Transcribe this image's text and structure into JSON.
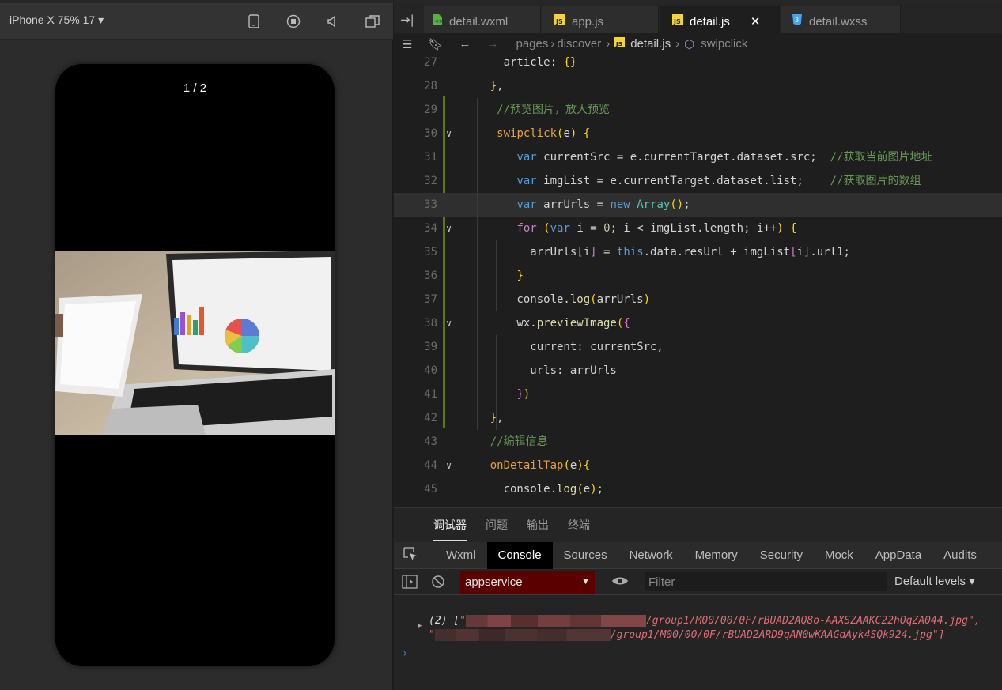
{
  "simulator": {
    "device": "iPhone X 75% 17 ▾",
    "pager": "1 / 2"
  },
  "tabs": [
    {
      "label": "detail.wxml",
      "icon": "wxml-file-icon"
    },
    {
      "label": "app.js",
      "icon": "js-file-icon"
    },
    {
      "label": "detail.js",
      "icon": "js-file-icon",
      "active": true,
      "close": "✕"
    },
    {
      "label": "detail.wxss",
      "icon": "css-file-icon"
    }
  ],
  "breadcrumb": {
    "parts": [
      "pages",
      "discover",
      "detail.js",
      "swipclick"
    ]
  },
  "editor": {
    "lines": [
      {
        "n": "27",
        "t": [
          [
            "v",
            "      article: "
          ],
          [
            "p1",
            "{}"
          ]
        ]
      },
      {
        "n": "28",
        "t": [
          [
            "v",
            "    "
          ],
          [
            "p1",
            "}"
          ],
          [
            "v",
            ","
          ]
        ]
      },
      {
        "n": "29",
        "t": [
          [
            "v",
            "     "
          ],
          [
            "c",
            "//预览图片，放大预览"
          ]
        ]
      },
      {
        "n": "30",
        "t": [
          [
            "v",
            "     "
          ],
          [
            "fn",
            "swipclick"
          ],
          [
            "p1",
            "("
          ],
          [
            "v",
            "e"
          ],
          [
            "p1",
            ")"
          ],
          [
            "v",
            " "
          ],
          [
            "p1",
            "{"
          ]
        ]
      },
      {
        "n": "31",
        "t": [
          [
            "v",
            "        "
          ],
          [
            "k",
            "var"
          ],
          [
            "v",
            " currentSrc = e.currentTarget.dataset.src;  "
          ],
          [
            "c",
            "//获取当前图片地址"
          ]
        ]
      },
      {
        "n": "32",
        "t": [
          [
            "v",
            "        "
          ],
          [
            "k",
            "var"
          ],
          [
            "v",
            " imgList = e.currentTarget.dataset.list;    "
          ],
          [
            "c",
            "//获取图片的数组"
          ]
        ]
      },
      {
        "n": "33",
        "t": [
          [
            "v",
            "        "
          ],
          [
            "k",
            "var"
          ],
          [
            "v",
            " arrUrls = "
          ],
          [
            "k",
            "new"
          ],
          [
            "v",
            " "
          ],
          [
            "cls",
            "Array"
          ],
          [
            "p1",
            "()"
          ],
          [
            "v",
            ";"
          ]
        ]
      },
      {
        "n": "34",
        "t": [
          [
            "v",
            "        "
          ],
          [
            "kk",
            "for"
          ],
          [
            "v",
            " "
          ],
          [
            "p1",
            "("
          ],
          [
            "k",
            "var"
          ],
          [
            "v",
            " i = "
          ],
          [
            "n",
            "0"
          ],
          [
            "v",
            "; i < imgList.length; i++"
          ],
          [
            "p1",
            ")"
          ],
          [
            "v",
            " "
          ],
          [
            "p1",
            "{"
          ]
        ]
      },
      {
        "n": "35",
        "t": [
          [
            "v",
            "          arrUrls"
          ],
          [
            "p2",
            "["
          ],
          [
            "v",
            "i"
          ],
          [
            "p2",
            "]"
          ],
          [
            "v",
            " = "
          ],
          [
            "this",
            "this"
          ],
          [
            "v",
            ".data.resUrl + imgList"
          ],
          [
            "p2",
            "["
          ],
          [
            "v",
            "i"
          ],
          [
            "p2",
            "]"
          ],
          [
            "v",
            ".url1;"
          ]
        ]
      },
      {
        "n": "36",
        "t": [
          [
            "v",
            "        "
          ],
          [
            "p1",
            "}"
          ]
        ]
      },
      {
        "n": "37",
        "t": [
          [
            "v",
            "        console."
          ],
          [
            "f",
            "log"
          ],
          [
            "p1",
            "("
          ],
          [
            "v",
            "arrUrls"
          ],
          [
            "p1",
            ")"
          ]
        ]
      },
      {
        "n": "38",
        "t": [
          [
            "v",
            "        wx."
          ],
          [
            "f",
            "previewImage"
          ],
          [
            "p1",
            "("
          ],
          [
            "p2",
            "{"
          ]
        ]
      },
      {
        "n": "39",
        "t": [
          [
            "v",
            "          current: currentSrc,"
          ]
        ]
      },
      {
        "n": "40",
        "t": [
          [
            "v",
            "          urls: arrUrls"
          ]
        ]
      },
      {
        "n": "41",
        "t": [
          [
            "v",
            "        "
          ],
          [
            "p2",
            "}"
          ],
          [
            "p1",
            ")"
          ]
        ]
      },
      {
        "n": "42",
        "t": [
          [
            "v",
            "    "
          ],
          [
            "p1",
            "}"
          ],
          [
            "v",
            ","
          ]
        ]
      },
      {
        "n": "43",
        "t": [
          [
            "v",
            "    "
          ],
          [
            "c",
            "//编辑信息"
          ]
        ]
      },
      {
        "n": "44",
        "t": [
          [
            "v",
            "    "
          ],
          [
            "fn",
            "onDetailTap"
          ],
          [
            "p1",
            "("
          ],
          [
            "v",
            "e"
          ],
          [
            "p1",
            ")"
          ],
          [
            "p1",
            "{"
          ]
        ]
      },
      {
        "n": "45",
        "t": [
          [
            "v",
            "      console."
          ],
          [
            "f",
            "log"
          ],
          [
            "p1",
            "("
          ],
          [
            "v",
            "e"
          ],
          [
            "p1",
            ")"
          ],
          [
            "v",
            ";"
          ]
        ]
      }
    ]
  },
  "panel_tabs": [
    "调试器",
    "问题",
    "输出",
    "终端"
  ],
  "devtools_tabs": [
    "Wxml",
    "Console",
    "Sources",
    "Network",
    "Memory",
    "Security",
    "Mock",
    "AppData",
    "Audits"
  ],
  "console": {
    "context": "appservice",
    "filter_placeholder": "Filter",
    "levels": "Default levels ▾",
    "log_prefix": "(2) [",
    "url1_tail": "/group1/M00/00/0F/rBUAD2AQ8o-AAXSZAAKC22hOqZA044.jpg\",",
    "url2_tail": "/group1/M00/00/0F/rBUAD2ARD9qAN0wKAAGdAyk4SQk924.jpg\"]",
    "prompt": "›"
  }
}
